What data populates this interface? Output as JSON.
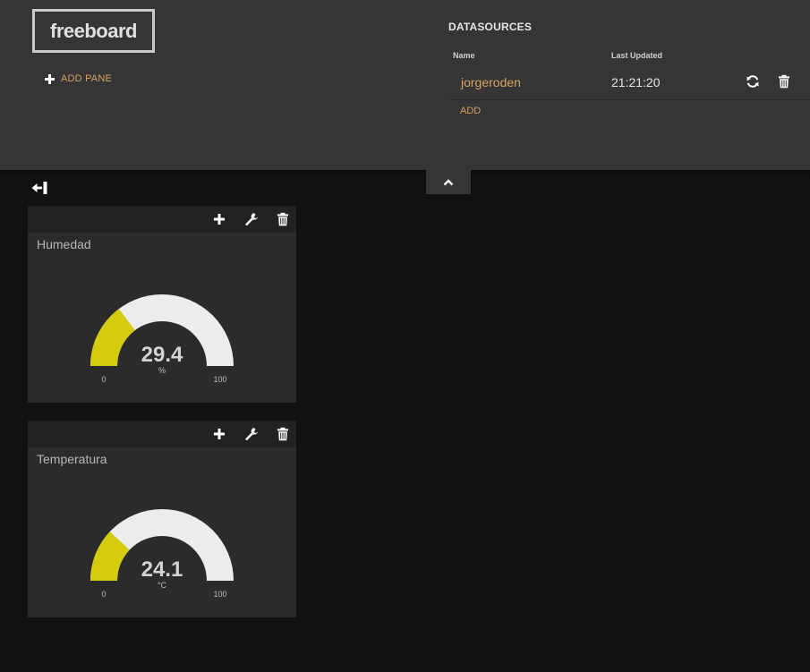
{
  "header": {
    "logo": "freeboard",
    "add_pane_label": "ADD PANE",
    "collapse_icon": "chevron-up-icon"
  },
  "datasources": {
    "title": "DATASOURCES",
    "col_name": "Name",
    "col_last_updated": "Last Updated",
    "rows": [
      {
        "name": "jorgeroden",
        "last_updated": "21:21:20"
      }
    ],
    "add_label": "ADD"
  },
  "panes": [
    {
      "title": "Humedad",
      "value": "29.4",
      "units": "%",
      "min": "0",
      "max": "100",
      "fraction": 0.294
    },
    {
      "title": "Temperatura",
      "value": "24.1",
      "units": "°C",
      "min": "0",
      "max": "100",
      "fraction": 0.241
    }
  ],
  "colors": {
    "gauge_fill": "#d4cc0c",
    "gauge_track": "#edebeb",
    "accent": "#d4a25f"
  }
}
